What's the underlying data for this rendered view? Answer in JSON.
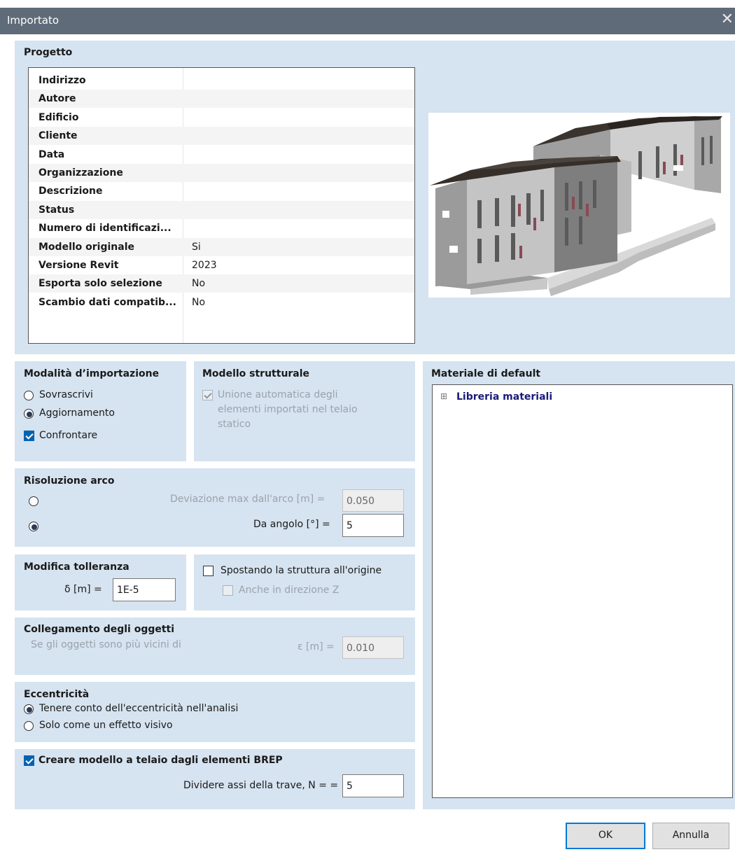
{
  "window": {
    "title": "Importato",
    "close_glyph": "✕"
  },
  "progetto": {
    "title": "Progetto",
    "rows": [
      {
        "key": "Indirizzo",
        "value": ""
      },
      {
        "key": "Autore",
        "value": ""
      },
      {
        "key": "Edificio",
        "value": ""
      },
      {
        "key": "Cliente",
        "value": ""
      },
      {
        "key": "Data",
        "value": ""
      },
      {
        "key": "Organizzazione",
        "value": ""
      },
      {
        "key": "Descrizione",
        "value": ""
      },
      {
        "key": "Status",
        "value": ""
      },
      {
        "key": "Numero di identificazi...",
        "value": ""
      },
      {
        "key": "Modello originale",
        "value": "Si"
      },
      {
        "key": "Versione Revit",
        "value": "2023"
      },
      {
        "key": "Esporta solo selezione",
        "value": "No"
      },
      {
        "key": "Scambio dati compatib...",
        "value": "No"
      }
    ]
  },
  "modalita": {
    "title": "Modalità d’importazione",
    "options": [
      "Sovrascrivi",
      "Aggiornamento"
    ],
    "selected": "Aggiornamento",
    "confrontare_label": "Confrontare",
    "confrontare_checked": true
  },
  "modello_strutturale": {
    "title": "Modello strutturale",
    "unione_line1": "Unione automatica degli",
    "unione_line2": "elementi importati nel telaio",
    "unione_line3": "statico",
    "unione_checked": true,
    "unione_enabled": false
  },
  "materiale": {
    "title": "Materiale di default",
    "tree_expander": "⊞",
    "tree_root": "Libreria materiali"
  },
  "risoluzione": {
    "title": "Risoluzione arco",
    "deviazione_label": "Deviazione max dall'arco [m] =",
    "deviazione_value": "0.050",
    "angolo_label": "Da angolo [°] =",
    "angolo_value": "5",
    "selected": "angolo"
  },
  "tolleranza": {
    "title": "Modifica tolleranza",
    "delta_label": "δ [m] =",
    "delta_value": "1E-5"
  },
  "spostando": {
    "label": "Spostando la struttura all'origine",
    "checked": false,
    "anche_label": "Anche in direzione Z",
    "anche_checked": false
  },
  "collegamento": {
    "title": "Collegamento degli oggetti",
    "desc": "Se gli oggetti sono più vicini di",
    "eps_label": "ε [m] =",
    "eps_value": "0.010"
  },
  "eccentricita": {
    "title": "Eccentricità",
    "options": [
      "Tenere conto dell'eccentricità nell'analisi",
      "Solo come un effetto visivo"
    ],
    "selected": 0
  },
  "brep": {
    "label": "Creare modello a telaio dagli elementi BREP",
    "checked": true,
    "dividere_label": "Dividere assi della trave, N = =",
    "dividere_value": "5"
  },
  "buttons": {
    "ok": "OK",
    "annulla": "Annulla"
  },
  "colors": {
    "panel": "#d6e3f0",
    "titlebar": "#5f6b78",
    "accent": "#0063b1"
  }
}
